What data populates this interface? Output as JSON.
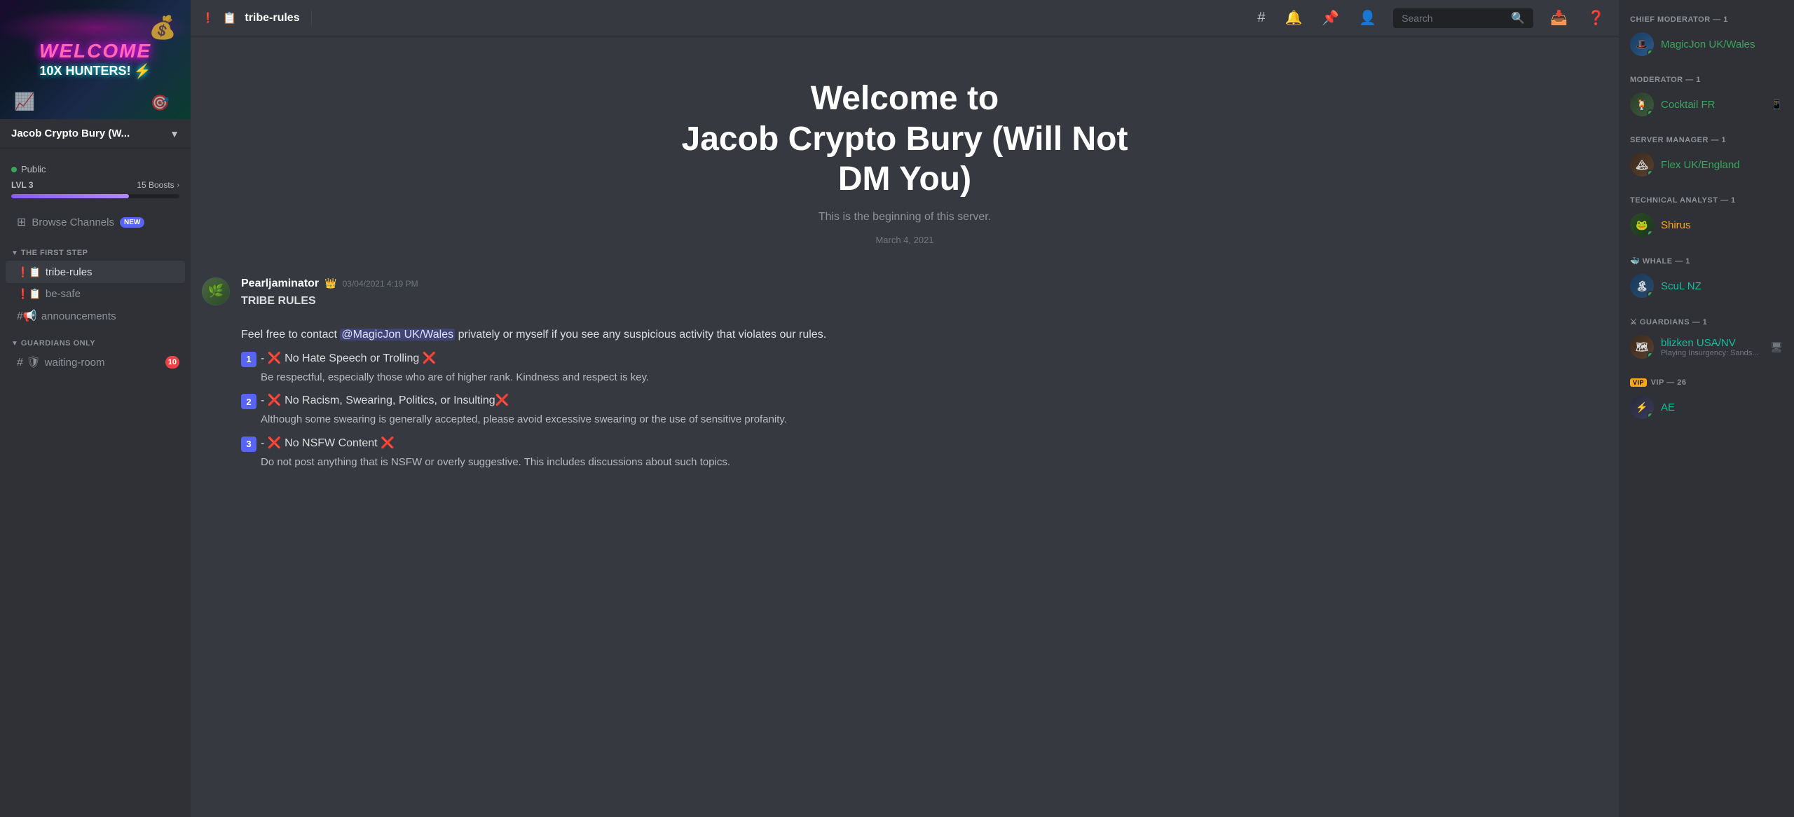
{
  "server": {
    "name": "Jacob Crypto Bury (W...",
    "full_name": "Jacob Crypto Bury (Will Not DM You)",
    "public_label": "Public",
    "banner_welcome": "WELCOME",
    "banner_hunters": "10X HUNTERS!",
    "lvl_label": "LVL 3",
    "boosts_label": "15 Boosts",
    "progress_pct": 70
  },
  "sidebar": {
    "browse_label": "Browse Channels",
    "browse_badge": "NEW",
    "categories": [
      {
        "name": "THE FIRST STEP",
        "channels": [
          {
            "type": "text",
            "icon": "📋",
            "name": "tribe-rules",
            "alert": true,
            "active": true
          },
          {
            "type": "text",
            "icon": "📋",
            "name": "be-safe",
            "alert": true
          },
          {
            "type": "text",
            "icon": "📢",
            "name": "announcements",
            "alert": false,
            "has_add": true
          }
        ]
      },
      {
        "name": "GUARDIANS ONLY",
        "channels": [
          {
            "type": "voice",
            "icon": "🛡",
            "name": "waiting-room",
            "badge": "10"
          }
        ]
      }
    ]
  },
  "topbar": {
    "channel_icon": "📋",
    "channel_name": "tribe-rules",
    "search_placeholder": "Search"
  },
  "main": {
    "intro_title_line1": "Welcome to",
    "intro_title_line2": "Jacob Crypto Bury (Will Not",
    "intro_title_line3": "DM You)",
    "intro_subtitle": "This is the beginning of this server.",
    "intro_date": "March 4, 2021",
    "message": {
      "author": "Pearljaminator",
      "author_crown": "👑",
      "timestamp": "03/04/2021 4:19 PM",
      "title": "TRIBE RULES",
      "intro_text": "Feel free to contact",
      "mention": "@MagicJon UK/Wales",
      "intro_text2": "privately or myself if you see any suspicious activity that violates our rules.",
      "rules": [
        {
          "num": "1",
          "header": "- ❌ No Hate Speech or Trolling ❌",
          "desc": "Be respectful, especially those who are of higher rank. Kindness and respect is key."
        },
        {
          "num": "2",
          "header": "- ❌ No Racism, Swearing, Politics, or Insulting❌",
          "desc": "Although some swearing is generally accepted, please avoid excessive swearing or the use of sensitive profanity."
        },
        {
          "num": "3",
          "header": "- ❌ No NSFW Content ❌",
          "desc": "Do not post anything that is NSFW or overly suggestive. This includes discussions about such topics."
        }
      ]
    }
  },
  "members": {
    "sections": [
      {
        "role": "CHIEF MODERATOR — 1",
        "members": [
          {
            "name": "MagicJon UK/Wales",
            "avatar_class": "avatar-magic-jon",
            "emoji": "🎩",
            "online": true,
            "color": "mod"
          }
        ]
      },
      {
        "role": "MODERATOR — 1",
        "members": [
          {
            "name": "Cocktail FR",
            "avatar_class": "avatar-cocktail",
            "emoji": "🟩",
            "online": true,
            "color": "mod"
          }
        ]
      },
      {
        "role": "SERVER MANAGER — 1",
        "members": [
          {
            "name": "Flex UK/England",
            "avatar_class": "avatar-flex",
            "emoji": "🏔",
            "online": true,
            "color": "mod"
          }
        ]
      },
      {
        "role": "TECHNICAL ANALYST — 1",
        "members": [
          {
            "name": "Shirus",
            "avatar_class": "avatar-shirus",
            "emoji": "🐸",
            "online": true,
            "color": "orange"
          }
        ]
      },
      {
        "role": "WHALE — 1",
        "members": [
          {
            "name": "ScuL NZ",
            "avatar_class": "avatar-scul",
            "emoji": "🐋",
            "online": true,
            "color": "teal"
          }
        ]
      },
      {
        "role": "GUARDIANS — 1",
        "members": [
          {
            "name": "blizken USA/NV",
            "avatar_class": "avatar-blizken",
            "emoji": "⚔",
            "online": true,
            "activity": "Playing Insurgency: Sands...",
            "color": "teal"
          }
        ]
      },
      {
        "role": "VIP — 26",
        "members": [
          {
            "name": "AE",
            "avatar_class": "avatar-ae",
            "emoji": "🛡",
            "online": true,
            "color": "teal",
            "badge": "VIP"
          }
        ]
      }
    ]
  }
}
